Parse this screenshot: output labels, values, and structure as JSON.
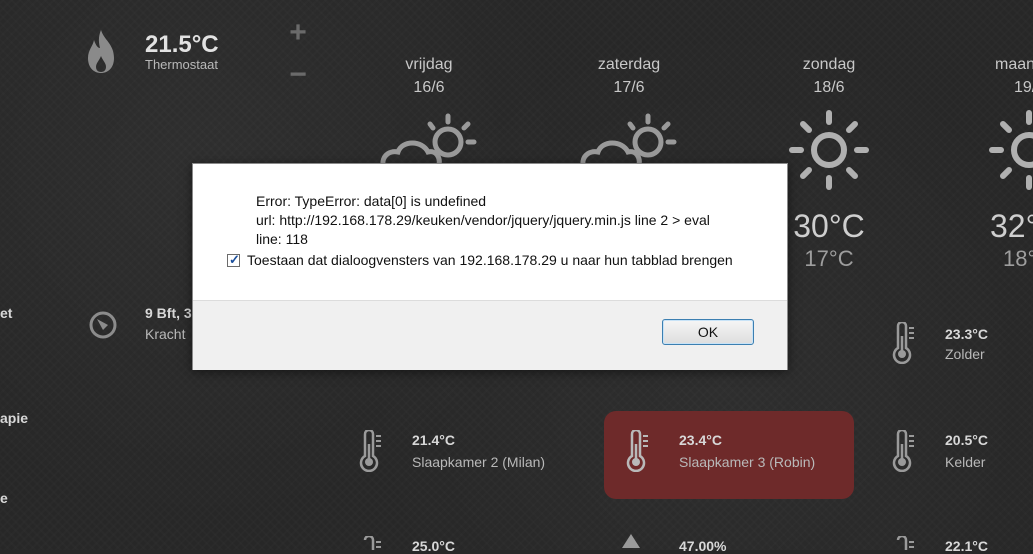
{
  "thermostat": {
    "value": "21.5°C",
    "label": "Thermostaat",
    "plus": "+",
    "minus": "−"
  },
  "forecast": [
    {
      "day": "vrijdag",
      "date": "16/6",
      "hi": "",
      "lo": "",
      "icon": "partly-cloudy-icon"
    },
    {
      "day": "zaterdag",
      "date": "17/6",
      "hi": "",
      "lo": "",
      "icon": "partly-cloudy-icon"
    },
    {
      "day": "zondag",
      "date": "18/6",
      "hi": "30°C",
      "lo": "17°C",
      "icon": "sun-icon"
    },
    {
      "day": "maan",
      "date": "19/",
      "hi": "32°",
      "lo": "18°",
      "icon": "sun-icon"
    }
  ],
  "left_labels": {
    "a": "et",
    "b": "apie",
    "c": "e"
  },
  "wind": {
    "value": "9 Bft, 3",
    "label": "Kracht"
  },
  "sensors": {
    "zolder": {
      "value": "23.3°C",
      "label": "Zolder"
    },
    "milan": {
      "value": "21.4°C",
      "label": "Slaapkamer 2 (Milan)"
    },
    "robin": {
      "value": "23.4°C",
      "label": "Slaapkamer 3 (Robin)"
    },
    "kelder": {
      "value": "20.5°C",
      "label": "Kelder"
    },
    "bottom1": {
      "value": "25.0°C"
    },
    "bottom2": {
      "value": "47.00%"
    },
    "bottom3": {
      "value": "22.1°C"
    }
  },
  "dialog": {
    "line1": "Error: TypeError: data[0] is undefined",
    "line2": "url: http://192.168.178.29/keuken/vendor/jquery/jquery.min.js line 2 > eval",
    "line3": "line: 118",
    "checkbox_label": "Toestaan dat dialoogvensters van 192.168.178.29 u naar hun tabblad brengen",
    "checked": true,
    "ok_label": "OK"
  }
}
